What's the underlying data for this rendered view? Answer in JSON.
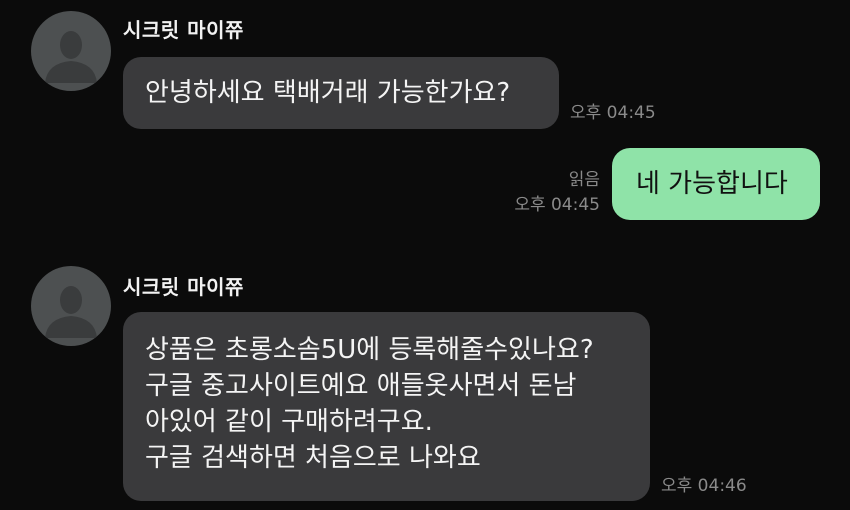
{
  "messages": [
    {
      "sender": "시크릿 마이쮸",
      "text": "안녕하세요 택배거래 가능한가요?",
      "time": "오후 04:45"
    },
    {
      "text": "네 가능합니다",
      "read": "읽음",
      "time": "오후 04:45"
    },
    {
      "sender": "시크릿 마이쮸",
      "lines": [
        "상품은 초롱소솜5U에 등록해줄수있나요?",
        "구글 중고사이트예요 애들옷사면서 돈남",
        "아있어 같이 구매하려구요.",
        "구글 검색하면 처음으로 나와요"
      ],
      "time": "오후 04:46"
    }
  ],
  "icons": {
    "avatar": "default-user-silhouette-icon"
  },
  "colors": {
    "background": "#0b0b0b",
    "incoming_bubble": "#3a3a3c",
    "outgoing_bubble": "#8fe3a8",
    "timestamp": "#8a8a8a"
  }
}
